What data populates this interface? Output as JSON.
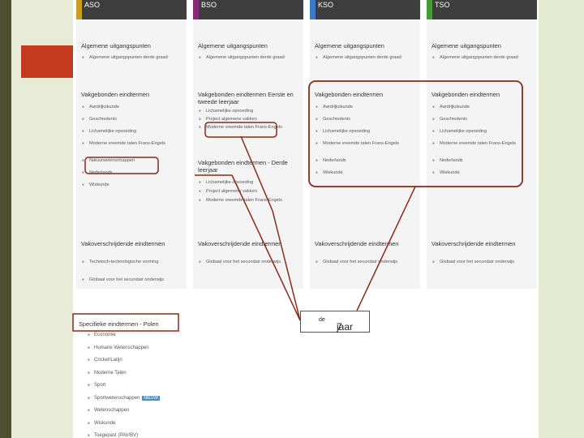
{
  "columns": [
    {
      "title": "ASO",
      "color": "#c8a020",
      "algemene": "Algemene uitgangspunten",
      "algemene_items": [
        "Algemene uitgangspunten derde graad"
      ],
      "vakgebonden": "Vakgebonden eindtermen",
      "vak_items": [
        "Aardrijkskunde",
        "Geschiedenis",
        "Lichamelijke opvoeding",
        "Moderne vreemde talen Frans-Engels",
        "Natuurwetenschappen",
        "Nederlands",
        "Wiskunde"
      ],
      "vakover": "Vakoverschrijdende eindtermen",
      "vakover_items": [
        "Technisch-technologische vorming",
        "Globaal voor het secundair onderwijs"
      ]
    },
    {
      "title": "BSO",
      "color": "#8a2a7a",
      "algemene": "Algemene uitgangspunten",
      "algemene_items": [
        "Algemene uitgangspunten derde graad"
      ],
      "vakgebonden": "Vakgebonden eindtermen Eerste en tweede leerjaar",
      "vak_items": [
        "Lichamelijke opvoeding",
        "Project algemene vakken",
        "Moderne vreemde talen Frans-Engels"
      ],
      "vakgebonden2": "Vakgebonden eindtermen - Derde leerjaar",
      "vak2_items": [
        "Lichamelijke opvoeding",
        "Project algemene vakken",
        "Moderne vreemde talen Frans-Engels"
      ],
      "vakover": "Vakoverschrijdende eindtermen",
      "vakover_items": [
        "Globaal voor het secundair onderwijs"
      ]
    },
    {
      "title": "KSO",
      "color": "#3a7ac8",
      "algemene": "Algemene uitgangspunten",
      "algemene_items": [
        "Algemene uitgangspunten derde graad"
      ],
      "vakgebonden": "Vakgebonden eindtermen",
      "vak_items": [
        "Aardrijkskunde",
        "Geschiedenis",
        "Lichamelijke opvoeding",
        "Moderne vreemde talen Frans-Engels",
        "Nederlands",
        "Wiskunde"
      ],
      "vakover": "Vakoverschrijdende eindtermen",
      "vakover_items": [
        "Globaal voor het secundair onderwijs"
      ]
    },
    {
      "title": "TSO",
      "color": "#4a9a3a",
      "algemene": "Algemene uitgangspunten",
      "algemene_items": [
        "Algemene uitgangspunten derde graad"
      ],
      "vakgebonden": "Vakgebonden eindtermen",
      "vak_items": [
        "Aardrijkskunde",
        "Geschiedenis",
        "Lichamelijke opvoeding",
        "Moderne vreemde talen Frans-Engels",
        "Nederlands",
        "Wiskunde"
      ],
      "vakover": "Vakoverschrijdende eindtermen",
      "vakover_items": [
        "Globaal voor het secundair onderwijs"
      ]
    }
  ],
  "specifieke": {
    "title": "Specifieke eindtermen - Polen",
    "items": [
      "Economie",
      "Humane Wetenschappen",
      "Cricket/Latijn",
      "Moderne Talen",
      "Sport",
      "Sportwetenschappen",
      "Wetenschappen",
      "Wiskunde",
      "Toegepast (PAV/BV)"
    ],
    "badge": "NIEUW!"
  },
  "annotation": {
    "num": "7",
    "sup": "de",
    "word": "jaar"
  },
  "accent_color": "#8a2a16"
}
